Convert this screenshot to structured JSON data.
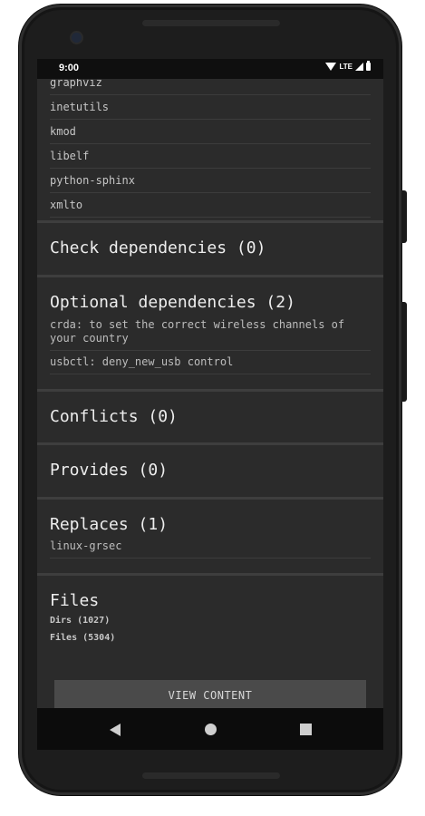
{
  "status": {
    "time": "9:00",
    "network": "LTE"
  },
  "depends_tail": [
    "graphviz",
    "inetutils",
    "kmod",
    "libelf",
    "python-sphinx",
    "xmlto"
  ],
  "check_deps": {
    "title": "Check dependencies (0)"
  },
  "optional_deps": {
    "title": "Optional dependencies (2)",
    "items": [
      "crda: to set the correct wireless channels of your country",
      "usbctl: deny_new_usb control"
    ]
  },
  "conflicts": {
    "title": "Conflicts (0)"
  },
  "provides": {
    "title": "Provides (0)"
  },
  "replaces": {
    "title": "Replaces (1)",
    "items": [
      "linux-grsec"
    ]
  },
  "files": {
    "title": "Files",
    "dirs": "Dirs (1027)",
    "files": "Files (5304)",
    "button": "VIEW CONTENT"
  },
  "icons": {
    "back": "back-icon",
    "home": "home-icon",
    "recents": "recents-icon"
  }
}
